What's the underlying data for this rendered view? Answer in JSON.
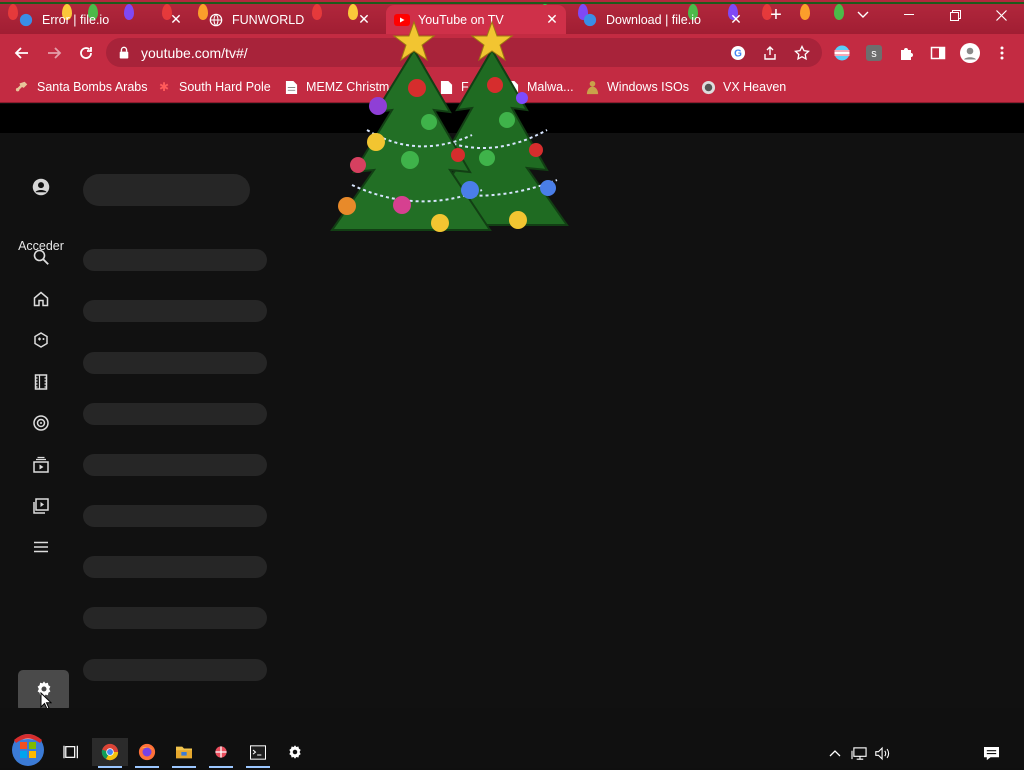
{
  "browser": {
    "tabs": [
      {
        "title": "Error | file.io",
        "active": false
      },
      {
        "title": "FUNWORLD",
        "active": false
      },
      {
        "title": "YouTube on TV",
        "active": true
      },
      {
        "title": "Download | file.io",
        "active": false
      }
    ],
    "url": "youtube.com/tv#/",
    "bookmarks": [
      {
        "label": "Santa Bombs Arabs",
        "icon": "guitar-icon"
      },
      {
        "label": "South Hard Pole",
        "icon": "snowflake-icon"
      },
      {
        "label": "MEMZ Christm",
        "icon": "page-icon"
      },
      {
        "label": "F",
        "icon": "page-icon"
      },
      {
        "label": "Malwa...",
        "icon": "page-icon"
      },
      {
        "label": "Windows ISOs",
        "icon": "buddha-icon"
      },
      {
        "label": "VX Heaven",
        "icon": "vx-icon"
      }
    ]
  },
  "youtube_tv": {
    "guide": {
      "signin_label": "Acceder",
      "items": [
        {
          "icon": "account-icon"
        },
        {
          "icon": "search-icon"
        },
        {
          "icon": "home-icon"
        },
        {
          "icon": "gaming-icon"
        },
        {
          "icon": "movies-icon"
        },
        {
          "icon": "music-icon"
        },
        {
          "icon": "subscriptions-icon"
        },
        {
          "icon": "library-icon"
        },
        {
          "icon": "menu-icon"
        },
        {
          "icon": "settings-icon"
        }
      ]
    },
    "placeholder_rows": 10
  },
  "colors": {
    "tab_strip": "#b3283d",
    "toolbar": "#c32b42",
    "page_bg": "#111111",
    "skeleton": "#262626",
    "settings_highlight": "#4a4a4a"
  },
  "taskbar": {
    "apps": [
      "start-icon",
      "task-view-icon",
      "chrome-icon",
      "firefox-icon",
      "file-explorer-icon",
      "app-icon",
      "terminal-icon",
      "settings-icon"
    ],
    "tray": [
      "chevron-up-icon",
      "network-icon",
      "volume-icon",
      "notifications-icon"
    ]
  }
}
